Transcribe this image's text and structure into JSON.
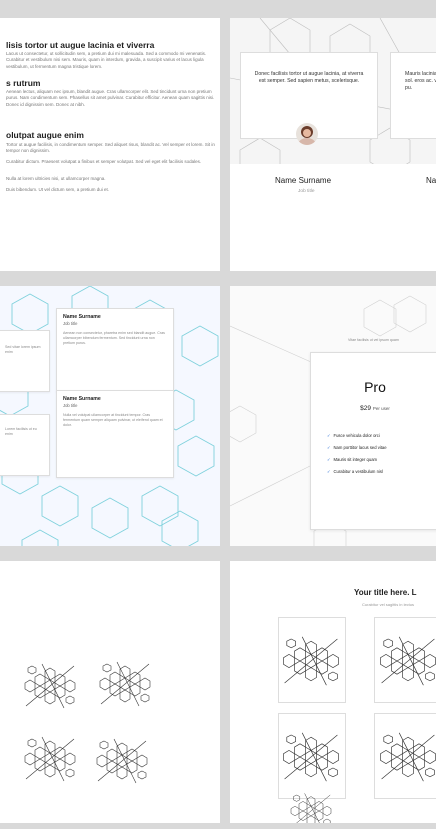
{
  "slide1": {
    "heading1": "lisis tortor ut augue lacinia et viverra",
    "para1": "Lacus ut consectetur, ut sollicitudin sem, a pretium dui mi malesuada. Sed a commodo mi venenatis. Curabitur et vestibulum nisi sem. Mauris, quam in interdum, gravida, a suscipit varius et lacus ligula vestibulum, ut fermentum magna tristique lorem.",
    "heading2": "s rutrum",
    "para2": "Aenean lectus, aliquam nec ipsum, blandit augue. Cras ullamcorper elit. Sed tincidunt urna non pretium purus. Nam condimentum sem. Phasellus sit amet pulvinar. Curabitur efficitur. Aenean quam sagittis nisi. Donec id dignissim sem. Donec at nibh.",
    "heading3": "olutpat augue enim",
    "para3": "Tortor ut augue facilisis, in condimentum semper. Sed aliquet risus, blandit ac. Vel semper et lorem. Sit in tempor non dignissim.",
    "para4": "Curabitur dictum. Praesent volutpat a finibus et semper volutpat. Sed vel eget elit facilisis sodales.",
    "para5": "Nulla at lorem ultricies nisi, ut ullamcorper magna.",
    "para6": "Duis bibendum. Ut vel dictum sem, a pretium dui et."
  },
  "slide2": {
    "quote1": "Donec facilisis tortor ut augue lacinia, at viverra est semper. Sed sapien metus, scelerisque.",
    "quote2_partial": "Mauris lacinia sol. eros ac. vel pu.",
    "name1": "Name Surname",
    "job1": "Job title",
    "name2_partial": "Na"
  },
  "slide3": {
    "card1_name": "Name Surname",
    "card1_role": "Job title",
    "card1_desc": "Aenean non consectetur, pharetra enim sed blandit augue. Cras ullamcorper bibendum fermentum. Sed tincidunt urna non pretium purus.",
    "card2_name": "Name Surname",
    "card2_role": "Job title",
    "card2_desc": "Nulla vel volutpat ullamcorper at tincidunt tempor. Cras fermentum quam semper aliquam pulvinar, ut eleifend quam et dolor.",
    "frag1": "Sed vitae lorem ipsum enim",
    "frag2": "Lorem facilisis ut eu enim"
  },
  "slide4": {
    "tier": "Pro",
    "price": "$29",
    "period": "Per user",
    "subtitle": "Vitae facilisis ut vel ipsum quam",
    "features": [
      "Fusce vehicula dolor orci",
      "Nam porttitor lacus sed vitae",
      "Mauris sit integer quam",
      "Curabitur a vestibulum nisl"
    ]
  },
  "slide6": {
    "title": "Your title here. L",
    "subtitle": "Curabitur vel sagittis in lectus"
  },
  "colors": {
    "accent": "#2b6fd6",
    "hexagon": "#7fd1dc",
    "board": "#d9d9d9"
  }
}
